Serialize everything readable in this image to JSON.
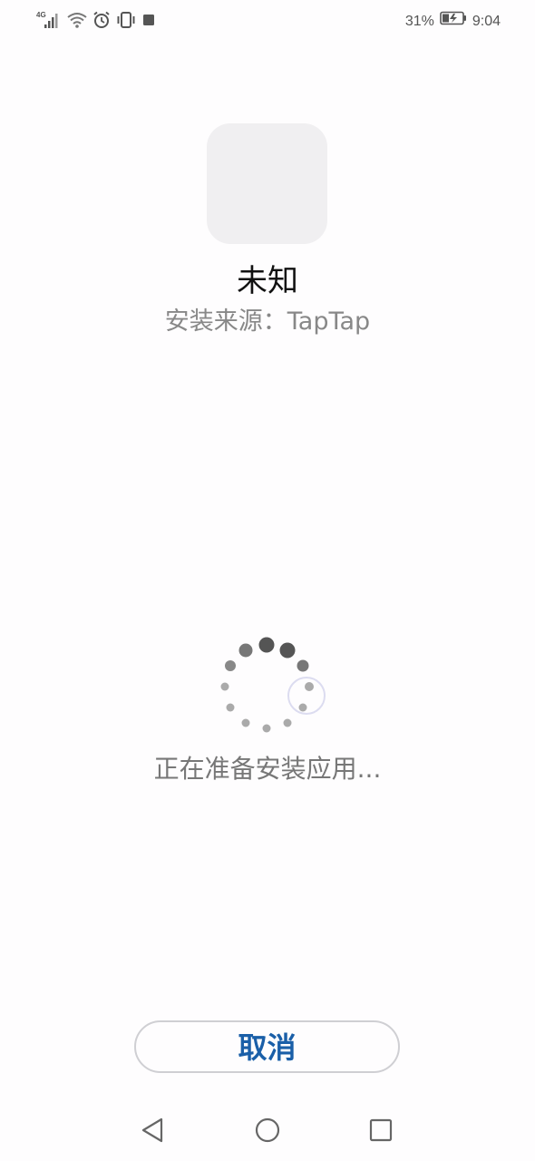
{
  "status_bar": {
    "network": "4G",
    "battery_percent": "31%",
    "time": "9:04",
    "icons": [
      "signal-icon",
      "wifi-icon",
      "alarm-icon",
      "vibrate-icon",
      "notification-square-icon",
      "battery-charging-icon"
    ]
  },
  "app": {
    "name": "未知",
    "source": "安装来源：TapTap"
  },
  "progress": {
    "message": "正在准备安装应用..."
  },
  "actions": {
    "cancel_label": "取消"
  },
  "nav": {
    "icons": [
      "back-icon",
      "home-icon",
      "recents-icon"
    ]
  },
  "colors": {
    "background": "#fefdfe",
    "accent": "#1a5fa8",
    "icon_placeholder": "#f0eff1"
  }
}
